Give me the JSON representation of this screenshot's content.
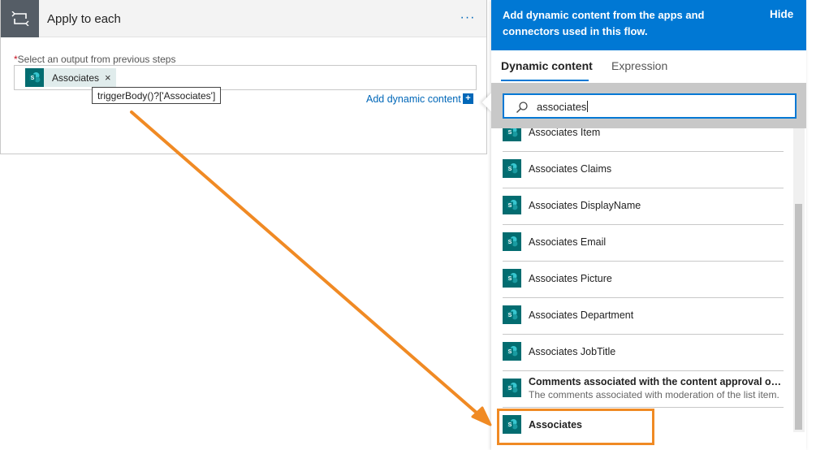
{
  "card": {
    "title": "Apply to each",
    "more_label": "···",
    "field_label": "Select an output from previous steps",
    "required_marker": "*",
    "token": {
      "label": "Associates",
      "close": "×"
    },
    "tooltip": "triggerBody()?['Associates']",
    "add_dynamic_content": "Add dynamic content",
    "add_plus": "+"
  },
  "panel": {
    "header_text": "Add dynamic content from the apps and connectors used in this flow.",
    "hide_label": "Hide",
    "tabs": [
      {
        "label": "Dynamic content",
        "active": true
      },
      {
        "label": "Expression",
        "active": false
      }
    ],
    "search_value": "associates",
    "items": [
      {
        "label": "Associates Item",
        "description": ""
      },
      {
        "label": "Associates Claims",
        "description": ""
      },
      {
        "label": "Associates DisplayName",
        "description": ""
      },
      {
        "label": "Associates Email",
        "description": ""
      },
      {
        "label": "Associates Picture",
        "description": ""
      },
      {
        "label": "Associates Department",
        "description": ""
      },
      {
        "label": "Associates JobTitle",
        "description": ""
      },
      {
        "label": "Comments associated with the content approval of this ...",
        "description": "The comments associated with moderation of the list item."
      },
      {
        "label": "Associates",
        "description": ""
      }
    ]
  },
  "icons": {
    "card_icon": "loop-icon",
    "token_icon": "sharepoint-icon",
    "search_icon": "search-icon"
  },
  "colors": {
    "accent": "#0078d4",
    "link": "#0067b8",
    "sharepoint": "#036c70",
    "card_icon_bg": "#555d66",
    "annotation": "#f08a24"
  }
}
